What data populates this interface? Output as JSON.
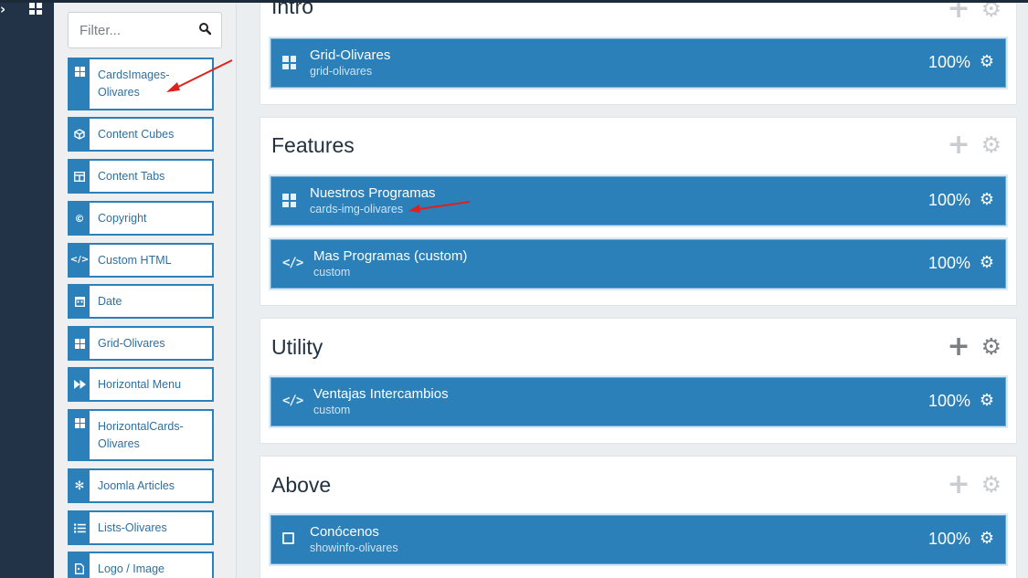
{
  "filter": {
    "placeholder": "Filter..."
  },
  "modules": [
    {
      "label": "CardsImages-Olivares",
      "icon": "grid-icon"
    },
    {
      "label": "Content Cubes",
      "icon": "cube-icon"
    },
    {
      "label": "Content Tabs",
      "icon": "tabs-icon"
    },
    {
      "label": "Copyright",
      "icon": "copyright-icon"
    },
    {
      "label": "Custom HTML",
      "icon": "code-icon"
    },
    {
      "label": "Date",
      "icon": "calendar-icon"
    },
    {
      "label": "Grid-Olivares",
      "icon": "grid-icon"
    },
    {
      "label": "Horizontal Menu",
      "icon": "fast-forward-icon"
    },
    {
      "label": "HorizontalCards-Olivares",
      "icon": "grid-icon"
    },
    {
      "label": "Joomla Articles",
      "icon": "joomla-icon"
    },
    {
      "label": "Lists-Olivares",
      "icon": "list-icon"
    },
    {
      "label": "Logo / Image",
      "icon": "file-image-icon"
    }
  ],
  "sections": [
    {
      "title": "Intro",
      "rows": [
        {
          "name": "Grid-Olivares",
          "sub": "grid-olivares",
          "width": "100%",
          "icon": "grid-icon"
        }
      ]
    },
    {
      "title": "Features",
      "rows": [
        {
          "name": "Nuestros Programas",
          "sub": "cards-img-olivares",
          "width": "100%",
          "icon": "grid-icon"
        },
        {
          "name": "Mas Programas (custom)",
          "sub": "custom",
          "width": "100%",
          "icon": "code-icon"
        }
      ]
    },
    {
      "title": "Utility",
      "rows": [
        {
          "name": "Ventajas Intercambios",
          "sub": "custom",
          "width": "100%",
          "icon": "code-icon"
        }
      ]
    },
    {
      "title": "Above",
      "rows": [
        {
          "name": "Conócenos",
          "sub": "showinfo-olivares",
          "width": "100%",
          "icon": "note-icon"
        }
      ]
    }
  ],
  "colors": {
    "accent": "#2b80b9",
    "rail": "#223247",
    "annotation": "#e0201b"
  }
}
